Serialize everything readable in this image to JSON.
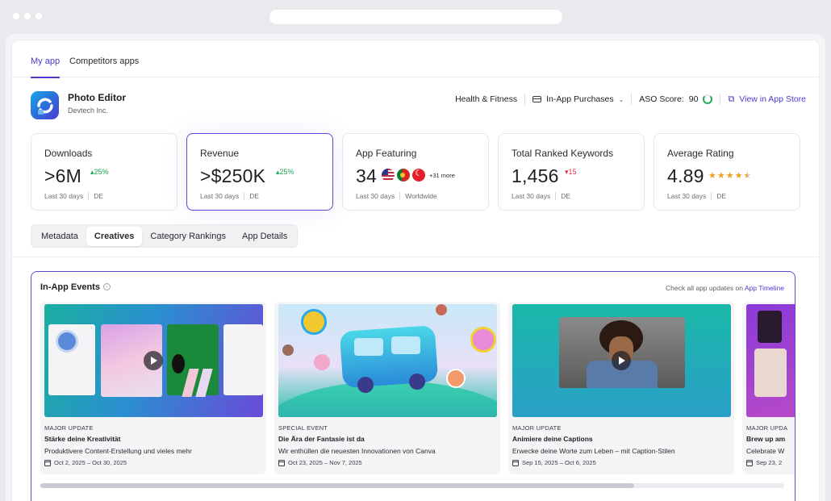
{
  "tabs": [
    {
      "label": "My app",
      "active": true
    },
    {
      "label": "Competitors apps",
      "active": false
    }
  ],
  "app": {
    "name": "Photo Editor",
    "developer": "Devtech Inc.",
    "category": "Health & Fitness",
    "monetization": "In-App Purchases",
    "aso_score_label": "ASO Score:",
    "aso_score": "90",
    "view_store_label": "View in App Store"
  },
  "stats": [
    {
      "title": "Downloads",
      "value": ">6M",
      "delta": "25%",
      "delta_dir": "up",
      "period": "Last 30 days",
      "region": "DE"
    },
    {
      "title": "Revenue",
      "value": ">$250K",
      "delta": "25%",
      "delta_dir": "up",
      "period": "Last 30 days",
      "region": "DE"
    },
    {
      "title": "App Featuring",
      "value": "34",
      "more": "+31 more",
      "period": "Last 30 days",
      "region": "Worldwide"
    },
    {
      "title": "Total Ranked Keywords",
      "value": "1,456",
      "delta": "15",
      "delta_dir": "down",
      "period": "Last 30 days",
      "region": "DE"
    },
    {
      "title": "Average Rating",
      "value": "4.89",
      "rating": 4.5,
      "period": "Last 30 days",
      "region": "DE"
    }
  ],
  "subtabs": [
    {
      "label": "Metadata",
      "active": false
    },
    {
      "label": "Creatives",
      "active": true
    },
    {
      "label": "Category Rankings",
      "active": false
    },
    {
      "label": "App Details",
      "active": false
    }
  ],
  "events_panel": {
    "title": "In-App Events",
    "note_prefix": "Check all app updates on ",
    "note_link": "App Timeline",
    "events": [
      {
        "type": "MAJOR UPDATE",
        "name": "Stärke deine Kreativität",
        "desc": "Produktivere Content-Erstellung und vieles mehr",
        "date": "Oct 2, 2025 – Oct 30, 2025"
      },
      {
        "type": "SPECIAL EVENT",
        "name": "Die Ära der Fantasie ist da",
        "desc": "Wir enthüllen die neuesten Innovationen von Canva",
        "date": "Oct 23, 2025 – Nov 7, 2025"
      },
      {
        "type": "MAJOR UPDATE",
        "name": "Animiere deine Captions",
        "desc": "Erwecke deine Worte zum Leben – mit Caption-Stilen",
        "date": "Sep 15, 2025 – Oct 6, 2025"
      },
      {
        "type": "MAJOR UPDA",
        "name": "Brew up am",
        "desc": "Celebrate W",
        "date": "Sep 23, 2"
      }
    ],
    "scroll_fraction": 0.8
  },
  "colors": {
    "accent": "#4a3bd0",
    "up": "#1fa35a",
    "down": "#d9334a",
    "star": "#f2a01b"
  }
}
